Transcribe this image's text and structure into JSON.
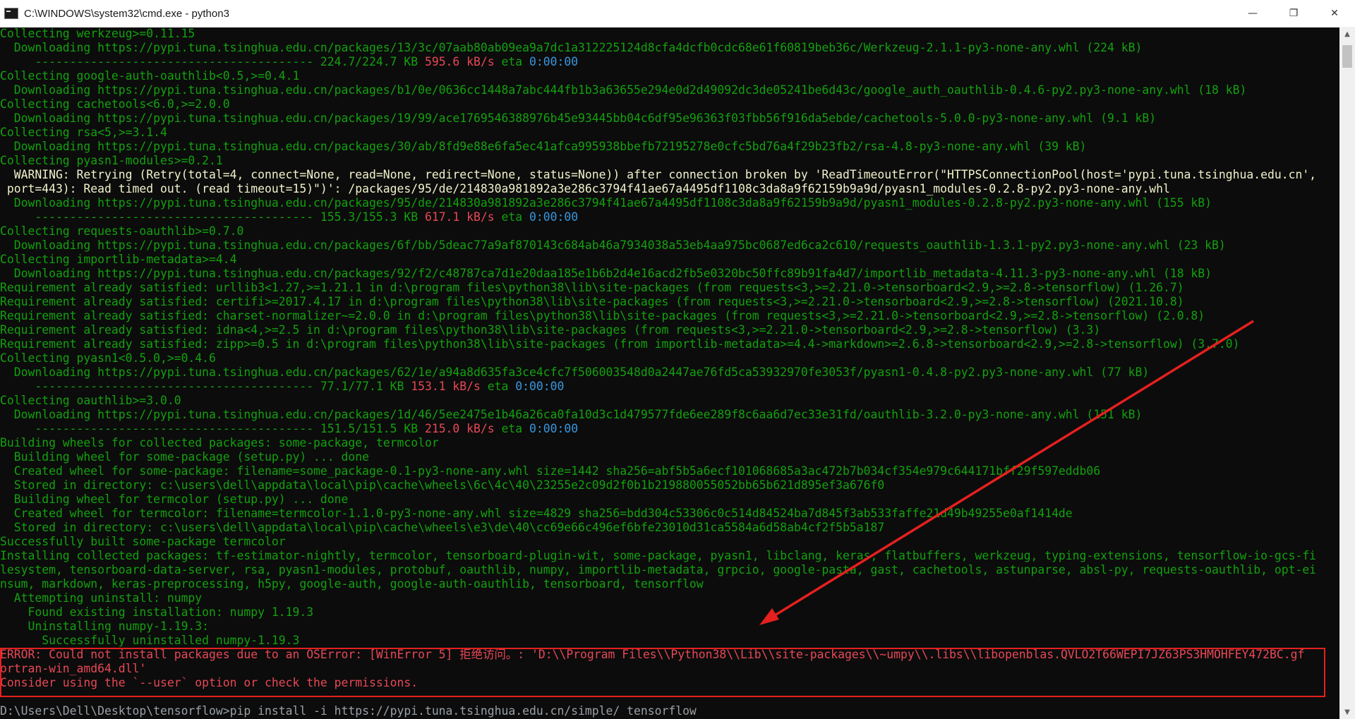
{
  "window": {
    "title": "C:\\WINDOWS\\system32\\cmd.exe - python3",
    "minimize_glyph": "—",
    "maximize_glyph": "❐",
    "close_glyph": "✕"
  },
  "icons": {
    "app": "cmd-icon",
    "minimize": "minimize-icon",
    "maximize": "restore-icon",
    "close": "close-icon"
  },
  "colors": {
    "console_text": "#13a10e",
    "warning_text": "#f2f2cc",
    "error_text": "#e74856",
    "annotation_red": "#e5201e"
  },
  "console": {
    "lines": [
      {
        "kind": "normal",
        "text": "Collecting werkzeug>=0.11.15"
      },
      {
        "kind": "normal",
        "text": "  Downloading https://pypi.tuna.tsinghua.edu.cn/packages/13/3c/07aab80ab09ea9a7dc1a312225124d8cfa4dcfb0cdc68e61f60819beb36c/Werkzeug-2.1.1-py3-none-any.whl (224 kB)"
      },
      {
        "kind": "progress",
        "bar": "     ---------------------------------------- 224.7/224.7 KB ",
        "rate": "595.6 kB/s",
        "eta_label": " eta ",
        "eta": "0:00:00"
      },
      {
        "kind": "normal",
        "text": "Collecting google-auth-oauthlib<0.5,>=0.4.1"
      },
      {
        "kind": "normal",
        "text": "  Downloading https://pypi.tuna.tsinghua.edu.cn/packages/b1/0e/0636cc1448a7abc444fb1b3a63655e294e0d2d49092dc3de05241be6d43c/google_auth_oauthlib-0.4.6-py2.py3-none-any.whl (18 kB)"
      },
      {
        "kind": "normal",
        "text": "Collecting cachetools<6.0,>=2.0.0"
      },
      {
        "kind": "normal",
        "text": "  Downloading https://pypi.tuna.tsinghua.edu.cn/packages/19/99/ace1769546388976b45e93445bb04c6df95e96363f03fbb56f916da5ebde/cachetools-5.0.0-py3-none-any.whl (9.1 kB)"
      },
      {
        "kind": "normal",
        "text": "Collecting rsa<5,>=3.1.4"
      },
      {
        "kind": "normal",
        "text": "  Downloading https://pypi.tuna.tsinghua.edu.cn/packages/30/ab/8fd9e88e6fa5ec41afca995938bbefb72195278e0cfc5bd76a4f29b23fb2/rsa-4.8-py3-none-any.whl (39 kB)"
      },
      {
        "kind": "normal",
        "text": "Collecting pyasn1-modules>=0.2.1"
      },
      {
        "kind": "warn",
        "text": "  WARNING: Retrying (Retry(total=4, connect=None, read=None, redirect=None, status=None)) after connection broken by 'ReadTimeoutError(\"HTTPSConnectionPool(host='pypi.tuna.tsinghua.edu.cn',"
      },
      {
        "kind": "warn",
        "text": " port=443): Read timed out. (read timeout=15)\")': /packages/95/de/214830a981892a3e286c3794f41ae67a4495df1108c3da8a9f62159b9a9d/pyasn1_modules-0.2.8-py2.py3-none-any.whl"
      },
      {
        "kind": "normal",
        "text": "  Downloading https://pypi.tuna.tsinghua.edu.cn/packages/95/de/214830a981892a3e286c3794f41ae67a4495df1108c3da8a9f62159b9a9d/pyasn1_modules-0.2.8-py2.py3-none-any.whl (155 kB)"
      },
      {
        "kind": "progress",
        "bar": "     ---------------------------------------- 155.3/155.3 KB ",
        "rate": "617.1 kB/s",
        "eta_label": " eta ",
        "eta": "0:00:00"
      },
      {
        "kind": "normal",
        "text": "Collecting requests-oauthlib>=0.7.0"
      },
      {
        "kind": "normal",
        "text": "  Downloading https://pypi.tuna.tsinghua.edu.cn/packages/6f/bb/5deac77a9af870143c684ab46a7934038a53eb4aa975bc0687ed6ca2c610/requests_oauthlib-1.3.1-py2.py3-none-any.whl (23 kB)"
      },
      {
        "kind": "normal",
        "text": "Collecting importlib-metadata>=4.4"
      },
      {
        "kind": "normal",
        "text": "  Downloading https://pypi.tuna.tsinghua.edu.cn/packages/92/f2/c48787ca7d1e20daa185e1b6b2d4e16acd2fb5e0320bc50ffc89b91fa4d7/importlib_metadata-4.11.3-py3-none-any.whl (18 kB)"
      },
      {
        "kind": "normal",
        "text": "Requirement already satisfied: urllib3<1.27,>=1.21.1 in d:\\program files\\python38\\lib\\site-packages (from requests<3,>=2.21.0->tensorboard<2.9,>=2.8->tensorflow) (1.26.7)"
      },
      {
        "kind": "normal",
        "text": "Requirement already satisfied: certifi>=2017.4.17 in d:\\program files\\python38\\lib\\site-packages (from requests<3,>=2.21.0->tensorboard<2.9,>=2.8->tensorflow) (2021.10.8)"
      },
      {
        "kind": "normal",
        "text": "Requirement already satisfied: charset-normalizer~=2.0.0 in d:\\program files\\python38\\lib\\site-packages (from requests<3,>=2.21.0->tensorboard<2.9,>=2.8->tensorflow) (2.0.8)"
      },
      {
        "kind": "normal",
        "text": "Requirement already satisfied: idna<4,>=2.5 in d:\\program files\\python38\\lib\\site-packages (from requests<3,>=2.21.0->tensorboard<2.9,>=2.8->tensorflow) (3.3)"
      },
      {
        "kind": "normal",
        "text": "Requirement already satisfied: zipp>=0.5 in d:\\program files\\python38\\lib\\site-packages (from importlib-metadata>=4.4->markdown>=2.6.8->tensorboard<2.9,>=2.8->tensorflow) (3.7.0)"
      },
      {
        "kind": "normal",
        "text": "Collecting pyasn1<0.5.0,>=0.4.6"
      },
      {
        "kind": "normal",
        "text": "  Downloading https://pypi.tuna.tsinghua.edu.cn/packages/62/1e/a94a8d635fa3ce4cfc7f506003548d0a2447ae76fd5ca53932970fe3053f/pyasn1-0.4.8-py2.py3-none-any.whl (77 kB)"
      },
      {
        "kind": "progress",
        "bar": "     ---------------------------------------- 77.1/77.1 KB ",
        "rate": "153.1 kB/s",
        "eta_label": " eta ",
        "eta": "0:00:00"
      },
      {
        "kind": "normal",
        "text": "Collecting oauthlib>=3.0.0"
      },
      {
        "kind": "normal",
        "text": "  Downloading https://pypi.tuna.tsinghua.edu.cn/packages/1d/46/5ee2475e1b46a26ca0fa10d3c1d479577fde6ee289f8c6aa6d7ec33e31fd/oauthlib-3.2.0-py3-none-any.whl (151 kB)"
      },
      {
        "kind": "progress",
        "bar": "     ---------------------------------------- 151.5/151.5 KB ",
        "rate": "215.0 kB/s",
        "eta_label": " eta ",
        "eta": "0:00:00"
      },
      {
        "kind": "normal",
        "text": "Building wheels for collected packages: some-package, termcolor"
      },
      {
        "kind": "normal",
        "text": "  Building wheel for some-package (setup.py) ... done"
      },
      {
        "kind": "normal",
        "text": "  Created wheel for some-package: filename=some_package-0.1-py3-none-any.whl size=1442 sha256=abf5b5a6ecf101068685a3ac472b7b034cf354e979c644171bff29f597eddb06"
      },
      {
        "kind": "normal",
        "text": "  Stored in directory: c:\\users\\dell\\appdata\\local\\pip\\cache\\wheels\\6c\\4c\\40\\23255e2c09d2f0b1b219880055052bb65b621d895ef3a676f0"
      },
      {
        "kind": "normal",
        "text": "  Building wheel for termcolor (setup.py) ... done"
      },
      {
        "kind": "normal",
        "text": "  Created wheel for termcolor: filename=termcolor-1.1.0-py3-none-any.whl size=4829 sha256=bdd304c53306c0c514d84524ba7d845f3ab533faffe21d49b49255e0af1414de"
      },
      {
        "kind": "normal",
        "text": "  Stored in directory: c:\\users\\dell\\appdata\\local\\pip\\cache\\wheels\\e3\\de\\40\\cc69e66c496ef6bfe23010d31ca5584a6d58ab4cf2f5b5a187"
      },
      {
        "kind": "normal",
        "text": "Successfully built some-package termcolor"
      },
      {
        "kind": "normal",
        "text": "Installing collected packages: tf-estimator-nightly, termcolor, tensorboard-plugin-wit, some-package, pyasn1, libclang, keras, flatbuffers, werkzeug, typing-extensions, tensorflow-io-gcs-fi"
      },
      {
        "kind": "normal",
        "text": "lesystem, tensorboard-data-server, rsa, pyasn1-modules, protobuf, oauthlib, numpy, importlib-metadata, grpcio, google-pasta, gast, cachetools, astunparse, absl-py, requests-oauthlib, opt-ei"
      },
      {
        "kind": "normal",
        "text": "nsum, markdown, keras-preprocessing, h5py, google-auth, google-auth-oauthlib, tensorboard, tensorflow"
      },
      {
        "kind": "normal",
        "text": "  Attempting uninstall: numpy"
      },
      {
        "kind": "normal",
        "text": "    Found existing installation: numpy 1.19.3"
      },
      {
        "kind": "normal",
        "text": "    Uninstalling numpy-1.19.3:"
      },
      {
        "kind": "normal",
        "text": "      Successfully uninstalled numpy-1.19.3"
      },
      {
        "kind": "err",
        "text": "ERROR: Could not install packages due to an OSError: [WinError 5] 拒绝访问。: 'D:\\\\Program Files\\\\Python38\\\\Lib\\\\site-packages\\\\~umpy\\\\.libs\\\\libopenblas.QVLO2T66WEPI7JZ63PS3HMOHFEY472BC.gf"
      },
      {
        "kind": "err",
        "text": "ortran-win_amd64.dll'"
      },
      {
        "kind": "err",
        "text": "Consider using the `--user` option or check the permissions."
      },
      {
        "kind": "blank",
        "text": ""
      },
      {
        "kind": "dim",
        "text": "D:\\Users\\Dell\\Desktop\\tensorflow>pip install -i https://pypi.tuna.tsinghua.edu.cn/simple/ tensorflow"
      }
    ]
  }
}
